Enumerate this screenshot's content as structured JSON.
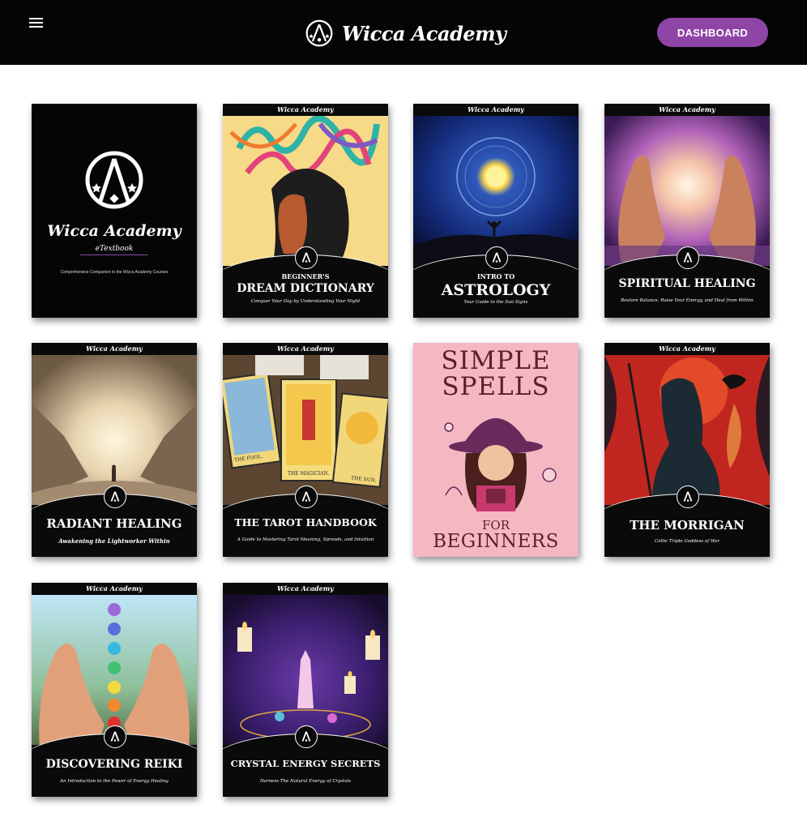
{
  "header": {
    "brand_name": "Wicca Academy",
    "dashboard_label": "DASHBOARD",
    "menu_icon": "hamburger-menu-icon",
    "logo_icon": "wicca-academy-logo-icon",
    "accent_color": "#8f45a6"
  },
  "books": [
    {
      "kind": "etextbook",
      "title": "Wicca Academy",
      "subtitle": "eTextbook",
      "description": "Comprehensive Companion to the Wicca Academy Courses"
    },
    {
      "brand": "Wicca Academy",
      "pre_title": "BEGINNER'S",
      "title": "DREAM DICTIONARY",
      "tagline": "Conquer Your Day by Understanding Your Night"
    },
    {
      "brand": "Wicca Academy",
      "pre_title": "INTRO TO",
      "title": "ASTROLOGY",
      "tagline": "Your Guide to the Sun Signs"
    },
    {
      "brand": "Wicca Academy",
      "pre_title": "",
      "title": "SPIRITUAL HEALING",
      "tagline": "Restore Balance, Raise Your Energy, and Heal from Within"
    },
    {
      "brand": "Wicca Academy",
      "pre_title": "",
      "title": "RADIANT HEALING",
      "tagline": "Awakening the Lightworker Within"
    },
    {
      "brand": "Wicca Academy",
      "pre_title": "",
      "title": "THE TAROT HANDBOOK",
      "tagline": "A Guide to Mastering Tarot Meaning, Spreads, and Intuition",
      "card_labels": [
        "THE FOOL.",
        "THE MAGICIAN.",
        "THE SUN."
      ]
    },
    {
      "kind": "spells",
      "title_line1": "SIMPLE",
      "title_line2": "SPELLS",
      "title_line3": "FOR",
      "title_line4": "BEGINNERS"
    },
    {
      "brand": "Wicca Academy",
      "pre_title": "",
      "title": "THE MORRIGAN",
      "tagline": "Celtic Triple Goddess of War"
    },
    {
      "brand": "Wicca Academy",
      "pre_title": "",
      "title": "DISCOVERING REIKI",
      "tagline": "An Introduction to the Power of Energy Healing"
    },
    {
      "brand": "Wicca Academy",
      "pre_title": "",
      "title": "CRYSTAL ENERGY SECRETS",
      "tagline": "Harness The Natural Energy of Crystals"
    }
  ]
}
